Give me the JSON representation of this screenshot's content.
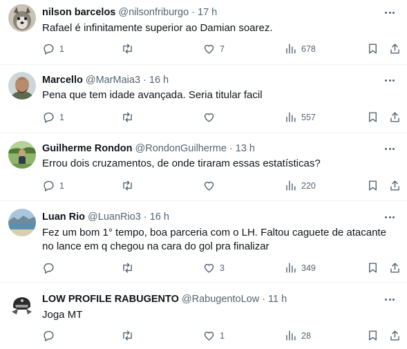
{
  "tweets": [
    {
      "name": "nilson barcelos",
      "handle": "@nilsonfriburgo",
      "sep": "·",
      "time": "17 h",
      "text": "Rafael é infinitamente superior ao Damian soarez.",
      "replies": "1",
      "retweets": "",
      "likes": "7",
      "views": "678",
      "avatar": "dog-photo"
    },
    {
      "name": "Marcello",
      "handle": "@MarMaia3",
      "sep": "·",
      "time": "16 h",
      "text": "Pena que tem idade avançada. Seria titular facil",
      "replies": "1",
      "retweets": "",
      "likes": "",
      "views": "557",
      "avatar": "man-photo"
    },
    {
      "name": "Guilherme Rondon",
      "handle": "@RondonGuilherme",
      "sep": "·",
      "time": "13 h",
      "text": "Errou dois cruzamentos, de onde tiraram essas estatísticas?",
      "replies": "1",
      "retweets": "",
      "likes": "",
      "views": "220",
      "avatar": "outdoor-photo"
    },
    {
      "name": "Luan Rio",
      "handle": "@LuanRio3",
      "sep": "·",
      "time": "16 h",
      "text": "Fez um bom 1° tempo, boa parceria com o LH. Faltou caguete de atacante no lance em q chegou na cara do gol pra finalizar",
      "replies": "",
      "retweets": "",
      "likes": "3",
      "views": "349",
      "avatar": "beach-photo"
    },
    {
      "name": "LOW PROFILE RABUGENTO",
      "handle": "@RabugentoLow",
      "sep": "·",
      "time": "11 h",
      "text": "Joga MT",
      "replies": "",
      "retweets": "",
      "likes": "1",
      "views": "28",
      "avatar": "helmet-logo"
    }
  ]
}
